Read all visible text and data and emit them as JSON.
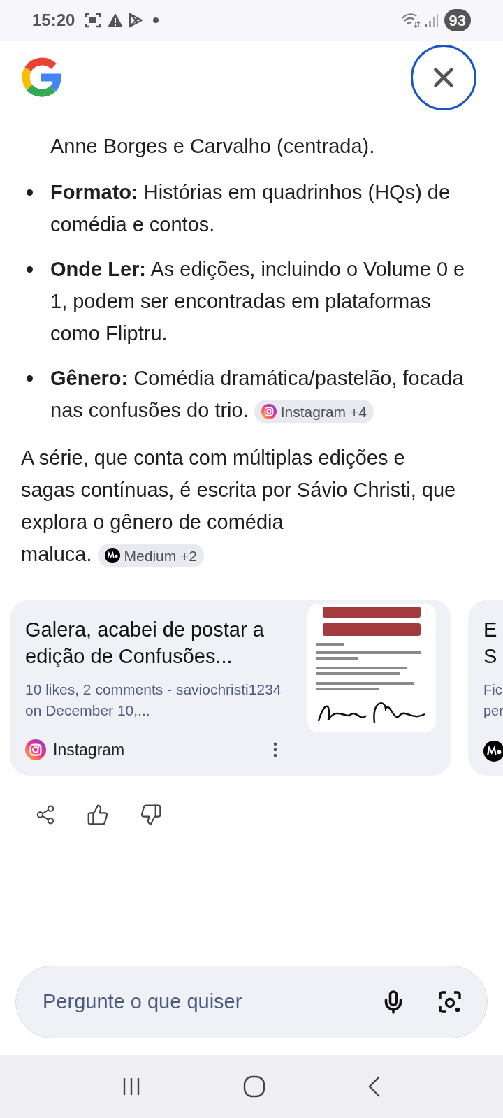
{
  "status_bar": {
    "time": "15:20",
    "battery": "93"
  },
  "answer": {
    "partial_item": {
      "line": "Anne Borges e Carvalho (centrada)."
    },
    "bullets": [
      {
        "text": "**Formato:** Histórias em quadrinhos (HQs) de comédia e contos."
      },
      {
        "text": "**Onde Ler:** As edições, incluindo o Volume 0 e 1, podem ser encontradas em plataformas como Fliptru."
      },
      {
        "text": "**Gênero:** Comédia dramática/pastelão, focada nas confusões do trio.",
        "chip": {
          "kind": "instagram",
          "source": "Instagram",
          "extra": "+4"
        }
      }
    ],
    "paragraph": {
      "text": "A série, que conta com múltiplas edições e sagas contínuas, é escrita por Sávio Christi, que explora o gênero de comédia",
      "tail": "maluca.",
      "chip": {
        "kind": "medium",
        "source": "Medium",
        "extra": "+2"
      }
    }
  },
  "cards": [
    {
      "title": "Galera, acabei de postar a edição de Confusões...",
      "meta": "10 likes, 2 comments - saviochristi1234 on December 10,...",
      "source": {
        "kind": "instagram",
        "name": "Instagram"
      }
    },
    {
      "title_lines": [
        "E",
        "S"
      ],
      "meta_lines": [
        "Fic",
        "per"
      ],
      "source": {
        "kind": "medium"
      }
    }
  ],
  "input": {
    "placeholder": "Pergunte o que quiser"
  }
}
